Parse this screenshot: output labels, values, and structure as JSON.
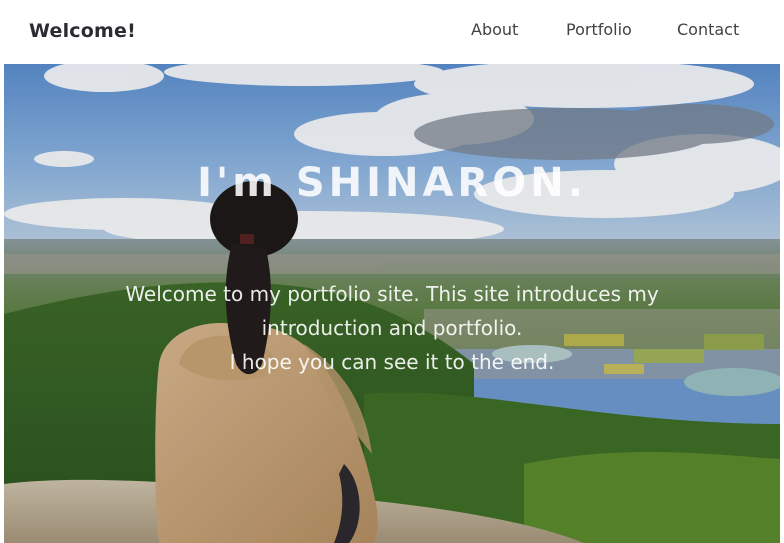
{
  "header": {
    "brand": "Welcome!",
    "nav": [
      "About",
      "Portfolio",
      "Contact"
    ]
  },
  "hero": {
    "title": "I'm SHINARON.",
    "description_lines": [
      "Welcome to my portfolio site. This site introduces my",
      "introduction and portfolio.",
      "I hope you can see it to the end."
    ],
    "image": "photo of a woman in a hooded jacket sitting on a rocky mountain summit overlooking a valley town under a cloudy blue sky"
  },
  "colors": {
    "brand_text": "#2e2a31",
    "nav_text": "#444046",
    "hero_text": "#ffffff"
  }
}
